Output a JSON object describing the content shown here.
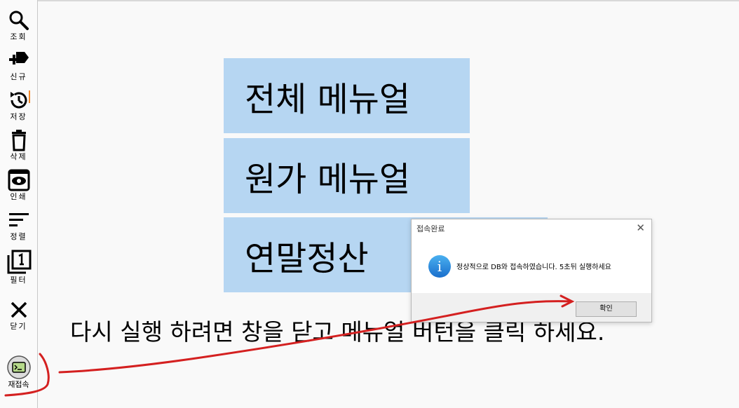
{
  "toolbar": {
    "items": [
      {
        "label": "조회",
        "icon": "search-icon"
      },
      {
        "label": "신규",
        "icon": "new-tag-icon"
      },
      {
        "label": "저장",
        "icon": "save-history-icon"
      },
      {
        "label": "삭제",
        "icon": "trash-icon"
      },
      {
        "label": "인쇄",
        "icon": "eye-print-icon"
      },
      {
        "label": "정렬",
        "icon": "sort-icon"
      },
      {
        "label": "필터",
        "icon": "filter-icon"
      },
      {
        "label": "닫기",
        "icon": "close-icon"
      }
    ],
    "reconnect_label": "재접속"
  },
  "menu": {
    "full_manual": "전체 메뉴얼",
    "cost_manual": "원가 메뉴얼",
    "year_end": "연말정산"
  },
  "message": "다시 실행 하려면 창을 닫고 메뉴얼 버턴을 클릭 하세요.",
  "dialog": {
    "title": "접속완료",
    "text": "정상적으로 DB와 접속하였습니다. 5초뒤 실행하세요",
    "ok_label": "확인",
    "icon": "info-icon"
  },
  "colors": {
    "menu_bg": "#b6d6f2",
    "annotation": "#d42020",
    "reconnect_icon": "#b5d98a",
    "save_accent": "#f5892a"
  }
}
